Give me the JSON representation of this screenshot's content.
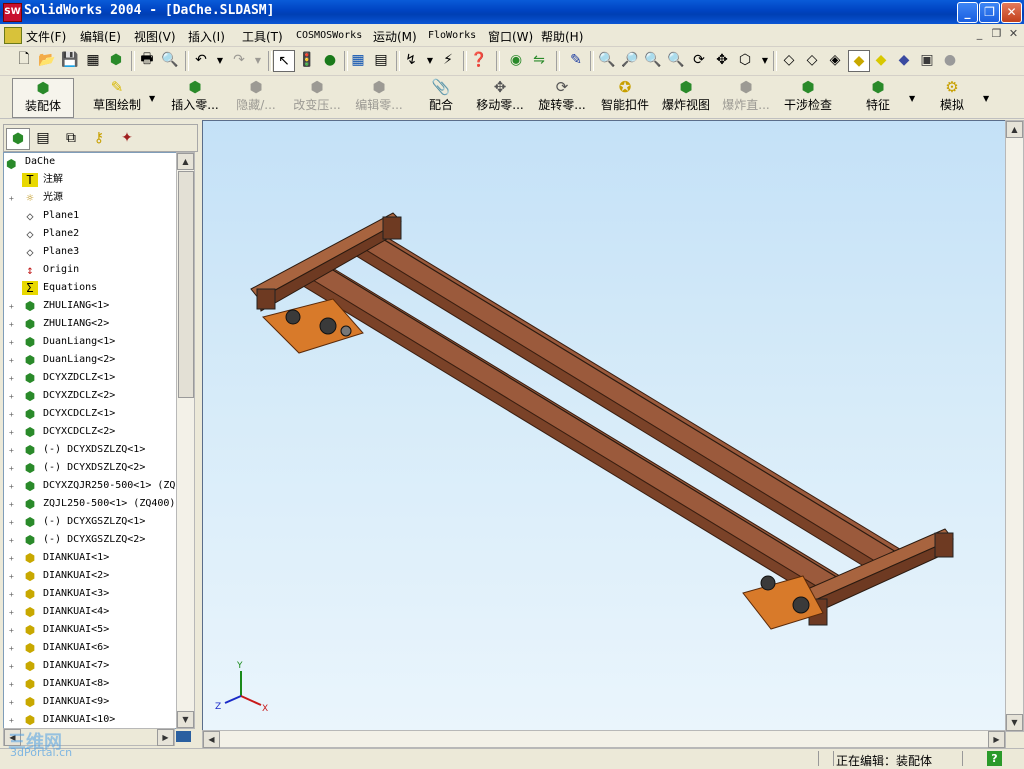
{
  "window": {
    "title": "SolidWorks 2004 - [DaChe.SLDASM]",
    "logo": "SW"
  },
  "menubar": {
    "items": [
      "文件(F)",
      "编辑(E)",
      "视图(V)",
      "插入(I)",
      "工具(T)",
      "COSMOSWorks",
      "运动(M)",
      "FloWorks",
      "窗口(W)",
      "帮助(H)"
    ]
  },
  "commandbar": {
    "buttons": [
      {
        "label": "装配体",
        "icon": "assembly-icon",
        "enabled": true
      },
      {
        "label": "草图绘制",
        "icon": "sketch-icon",
        "enabled": true
      },
      {
        "label": "插入零...",
        "icon": "insert-component-icon",
        "enabled": true
      },
      {
        "label": "隐藏/...",
        "icon": "hide-show-icon",
        "enabled": false
      },
      {
        "label": "改变压...",
        "icon": "change-suppression-icon",
        "enabled": false
      },
      {
        "label": "编辑零...",
        "icon": "edit-component-icon",
        "enabled": false
      },
      {
        "label": "配合",
        "icon": "mate-icon",
        "enabled": true
      },
      {
        "label": "移动零...",
        "icon": "move-component-icon",
        "enabled": true
      },
      {
        "label": "旋转零...",
        "icon": "rotate-component-icon",
        "enabled": true
      },
      {
        "label": "智能扣件",
        "icon": "smart-fasteners-icon",
        "enabled": true
      },
      {
        "label": "爆炸视图",
        "icon": "exploded-view-icon",
        "enabled": true
      },
      {
        "label": "爆炸直...",
        "icon": "explode-line-icon",
        "enabled": false
      },
      {
        "label": "干涉检查",
        "icon": "interference-check-icon",
        "enabled": true
      },
      {
        "label": "特征",
        "icon": "features-icon",
        "enabled": true
      },
      {
        "label": "模拟",
        "icon": "simulation-icon",
        "enabled": true
      }
    ]
  },
  "tree": {
    "root": "DaChe",
    "items": [
      {
        "label": "注解",
        "icon": "annotation-icon",
        "expand": false
      },
      {
        "label": "光源",
        "icon": "lights-icon",
        "expand": true
      },
      {
        "label": "Plane1",
        "icon": "plane-icon",
        "expand": false
      },
      {
        "label": "Plane2",
        "icon": "plane-icon",
        "expand": false
      },
      {
        "label": "Plane3",
        "icon": "plane-icon",
        "expand": false
      },
      {
        "label": "Origin",
        "icon": "origin-icon",
        "expand": false
      },
      {
        "label": "Equations",
        "icon": "equations-icon",
        "expand": false
      },
      {
        "label": "ZHULIANG<1>",
        "icon": "subassembly-icon",
        "expand": true
      },
      {
        "label": "ZHULIANG<2>",
        "icon": "subassembly-icon",
        "expand": true
      },
      {
        "label": "DuanLiang<1>",
        "icon": "subassembly-icon",
        "expand": true
      },
      {
        "label": "DuanLiang<2>",
        "icon": "subassembly-icon",
        "expand": true
      },
      {
        "label": "DCYXZDCLZ<1>",
        "icon": "subassembly-icon",
        "expand": true
      },
      {
        "label": "DCYXZDCLZ<2>",
        "icon": "subassembly-icon",
        "expand": true
      },
      {
        "label": "DCYXCDCLZ<1>",
        "icon": "subassembly-icon",
        "expand": true
      },
      {
        "label": "DCYXCDCLZ<2>",
        "icon": "subassembly-icon",
        "expand": true
      },
      {
        "label": "(-) DCYXDSZLZQ<1>",
        "icon": "subassembly-icon",
        "expand": true
      },
      {
        "label": "(-) DCYXDSZLZQ<2>",
        "icon": "subassembly-icon",
        "expand": true
      },
      {
        "label": "DCYXZQJR250-500<1> (ZQ",
        "icon": "subassembly-icon",
        "expand": true
      },
      {
        "label": "ZQJL250-500<1> (ZQ400)",
        "icon": "subassembly-icon",
        "expand": true
      },
      {
        "label": "(-) DCYXGSZLZQ<1>",
        "icon": "subassembly-icon",
        "expand": true
      },
      {
        "label": "(-) DCYXGSZLZQ<2>",
        "icon": "subassembly-icon",
        "expand": true
      },
      {
        "label": "DIANKUAI<1>",
        "icon": "part-icon",
        "expand": true
      },
      {
        "label": "DIANKUAI<2>",
        "icon": "part-icon",
        "expand": true
      },
      {
        "label": "DIANKUAI<3>",
        "icon": "part-icon",
        "expand": true
      },
      {
        "label": "DIANKUAI<4>",
        "icon": "part-icon",
        "expand": true
      },
      {
        "label": "DIANKUAI<5>",
        "icon": "part-icon",
        "expand": true
      },
      {
        "label": "DIANKUAI<6>",
        "icon": "part-icon",
        "expand": true
      },
      {
        "label": "DIANKUAI<7>",
        "icon": "part-icon",
        "expand": true
      },
      {
        "label": "DIANKUAI<8>",
        "icon": "part-icon",
        "expand": true
      },
      {
        "label": "DIANKUAI<9>",
        "icon": "part-icon",
        "expand": true
      },
      {
        "label": "DIANKUAI<10>",
        "icon": "part-icon",
        "expand": true
      }
    ]
  },
  "viewport": {
    "triad": {
      "x": "X",
      "y": "Y",
      "z": "Z"
    },
    "model_color": "#9b5a3c"
  },
  "status": {
    "text": "正在编辑：装配体",
    "help": "?"
  },
  "watermark": {
    "brand": "三维网",
    "site": "3dPortal.cn"
  }
}
